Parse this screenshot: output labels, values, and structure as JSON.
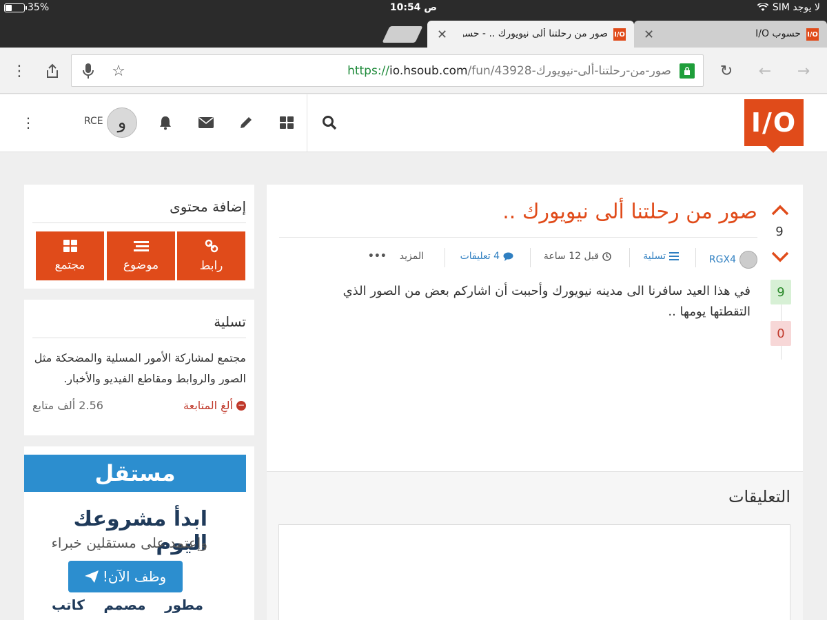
{
  "status_bar": {
    "carrier": "لا يوجد SIM",
    "time": "10:54 ص",
    "battery": "35%"
  },
  "tabs": [
    {
      "title": "صور من رحلتنا ألى نيويورك .. - حسو",
      "favicon": "I/O",
      "active": true
    },
    {
      "title": "حسوب I/O",
      "favicon": "I/O",
      "active": false
    }
  ],
  "toolbar": {
    "url_scheme": "https://",
    "url_host": "io.hsoub.com",
    "url_path": "/fun/43928-صور-من-رحلتنا-ألى-نيويورك"
  },
  "site_header": {
    "logo_text": "I/O",
    "username": "RCE",
    "avatar_glyph": "و"
  },
  "post": {
    "title": "صور من رحلتنا ألى نيويورك ..",
    "votes": "9",
    "author": "RGX4",
    "category": "تسلية",
    "time_ago": "قبل 12 ساعة",
    "comments_count": "4 تعليقات",
    "more_label": "المزيد",
    "body": "في هذا العيد سافرنا الى مدينه نيويورك وأحببت أن اشاركم بعض من الصور الذي التقطتها يومها ..",
    "upvotes": "9",
    "downvotes": "0"
  },
  "comments": {
    "title": "التعليقات"
  },
  "sidebar": {
    "add_content": {
      "title": "إضافة محتوى",
      "buttons": [
        {
          "label": "رابط",
          "icon": "link-icon"
        },
        {
          "label": "موضوع",
          "icon": "list-icon"
        },
        {
          "label": "مجتمع",
          "icon": "grid-icon"
        }
      ]
    },
    "category": {
      "title": "تسلية",
      "description": "مجتمع لمشاركة الأمور المسلية والمضحكة مثل الصور والروابط ومقاطع الفيديو والأخبار.",
      "unfollow_label": "ألغِ المتابعة",
      "followers": "2.56 ألف متابع"
    },
    "ad": {
      "brand": "مستقل",
      "headline": "ابدأ مشروعك اليوم",
      "subline": "وإعتمد على مستقلين خبراء",
      "cta": "وظف الآن!",
      "roles": [
        "مطور",
        "مصمم",
        "كاتب"
      ]
    }
  },
  "colors": {
    "brand": "#e04b1a",
    "link": "#2f7fc1",
    "ad_blue": "#2c8ecf"
  }
}
